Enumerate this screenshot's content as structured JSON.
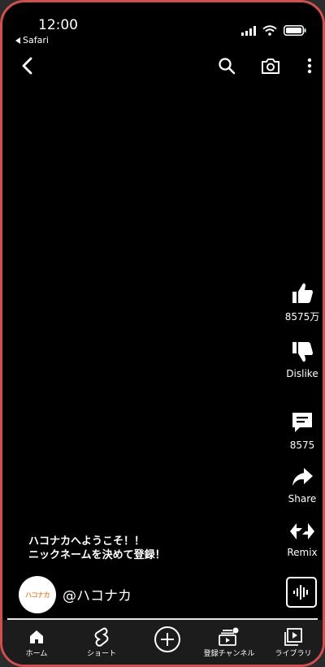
{
  "status": {
    "time": "12:00",
    "back_app": "Safari"
  },
  "actions": {
    "like_count": "8575万",
    "dislike_label": "Dislike",
    "comment_count": "8575",
    "share_label": "Share",
    "remix_label": "Remix"
  },
  "caption": {
    "line1": "ハコナカへようこそ！！",
    "line2": "ニックネームを決めて登録！"
  },
  "channel": {
    "avatar_text": "ハコナカ",
    "handle": "@ハコナカ"
  },
  "nav": {
    "home": "ホーム",
    "shorts": "ショート",
    "subscriptions": "登録チャンネル",
    "library": "ライブラリ"
  },
  "colors": {
    "frame": "#d05050",
    "background": "#000000",
    "nav_bg": "#1c1c1c"
  }
}
